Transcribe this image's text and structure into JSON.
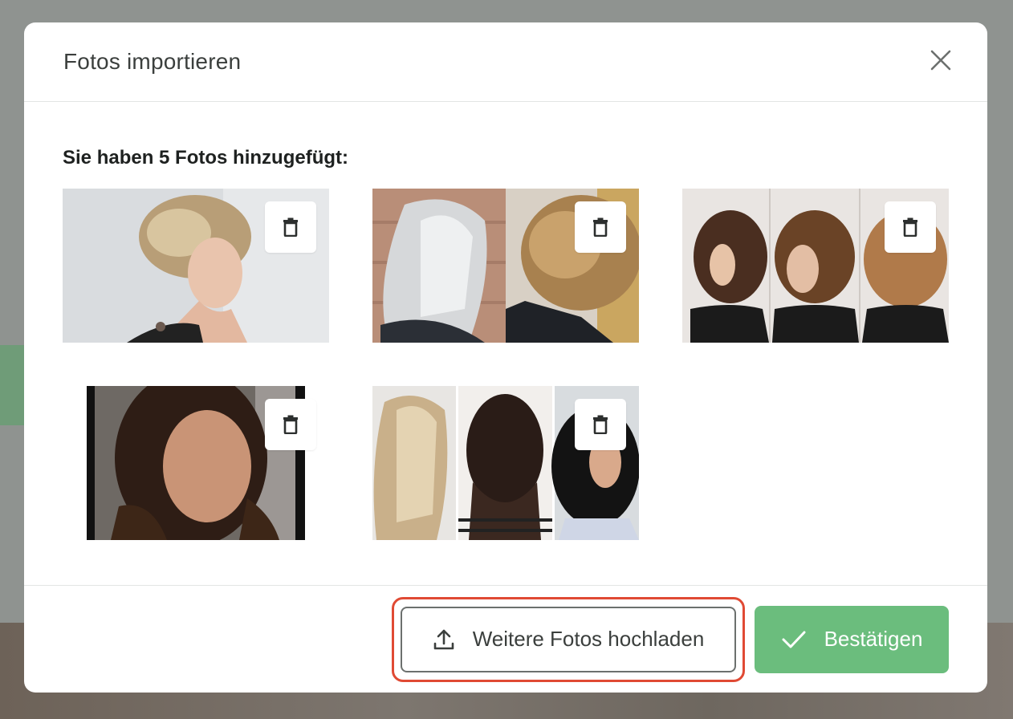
{
  "dialog": {
    "title": "Fotos importieren",
    "close_icon": "close-icon"
  },
  "body": {
    "count_text": "Sie haben 5 Fotos hinzugefügt:",
    "photos": [
      {
        "alt": "Foto 1",
        "delete_icon": "trash-icon"
      },
      {
        "alt": "Foto 2",
        "delete_icon": "trash-icon"
      },
      {
        "alt": "Foto 3",
        "delete_icon": "trash-icon"
      },
      {
        "alt": "Foto 4",
        "delete_icon": "trash-icon"
      },
      {
        "alt": "Foto 5",
        "delete_icon": "trash-icon"
      }
    ]
  },
  "footer": {
    "upload_label": "Weitere Fotos hochladen",
    "upload_icon": "upload-icon",
    "confirm_label": "Bestätigen",
    "confirm_icon": "checkmark-icon"
  },
  "colors": {
    "accent_green": "#6bbd7d",
    "highlight_red": "#e04a34",
    "overlay": "#8f9390"
  }
}
